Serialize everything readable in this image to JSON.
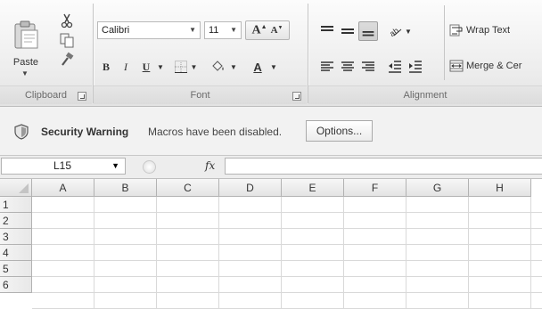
{
  "ribbon": {
    "clipboard": {
      "label": "Clipboard",
      "paste_label": "Paste",
      "icons": [
        "paste-icon",
        "cut-icon",
        "copy-icon",
        "format-painter-icon"
      ]
    },
    "font": {
      "label": "Font",
      "font_name": "Calibri",
      "font_size": "11",
      "bold": "B",
      "italic": "I",
      "underline": "U",
      "font_color_letter": "A",
      "grow_letter": "A",
      "shrink_letter": "A",
      "font_color_bar": "#e03030",
      "icons": [
        "grow-font-icon",
        "shrink-font-icon",
        "borders-icon",
        "fill-color-icon",
        "font-color-icon"
      ]
    },
    "alignment": {
      "label": "Alignment",
      "wrap_text": "Wrap Text",
      "merge_center": "Merge & Cer",
      "icons": [
        "align-top-icon",
        "align-middle-icon",
        "align-bottom-icon",
        "orientation-icon",
        "align-left-icon",
        "align-center-icon",
        "align-right-icon",
        "decrease-indent-icon",
        "increase-indent-icon",
        "wrap-text-icon",
        "merge-center-icon"
      ]
    }
  },
  "message_bar": {
    "title": "Security Warning",
    "text": "Macros have been disabled.",
    "button": "Options...",
    "icon": "shield-icon"
  },
  "formula_bar": {
    "name_box": "L15",
    "fx_label": "fx",
    "formula": ""
  },
  "sheet": {
    "columns": [
      "A",
      "B",
      "C",
      "D",
      "E",
      "F",
      "G",
      "H"
    ],
    "rows": [
      "1",
      "2",
      "3",
      "4",
      "5",
      "6"
    ]
  }
}
